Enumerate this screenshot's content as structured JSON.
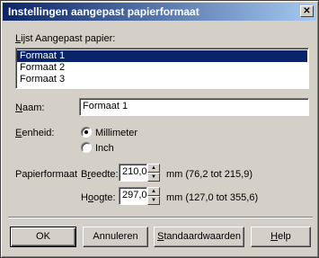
{
  "window": {
    "title": "Instellingen aangepast papierformaat",
    "close_icon": "close-icon"
  },
  "list": {
    "label_first": "L",
    "label_rest": "ijst Aangepast papier:",
    "items": [
      "Formaat 1",
      "Formaat 2",
      "Formaat 3"
    ],
    "selected_index": 0
  },
  "name": {
    "label_first": "N",
    "label_rest": "aam:",
    "value": "Formaat 1"
  },
  "unit": {
    "label_first": "E",
    "label_rest": "enheid:",
    "options": [
      "Millimeter",
      "Inch"
    ],
    "selected": "Millimeter"
  },
  "paper": {
    "label": "Papierformaat",
    "width_label_pre": "B",
    "width_label_u": "r",
    "width_label_post": "eedte:",
    "width_value": "210,0",
    "width_range": "mm (76,2 tot 215,9)",
    "height_label_pre": "H",
    "height_label_u": "o",
    "height_label_post": "ogte:",
    "height_value": "297,0",
    "height_range": "mm (127,0 tot 355,6)"
  },
  "buttons": {
    "ok": "OK",
    "cancel": "Annuleren",
    "defaults_first": "S",
    "defaults_rest": "tandaardwaarden",
    "help_first": "H",
    "help_rest": "elp"
  }
}
